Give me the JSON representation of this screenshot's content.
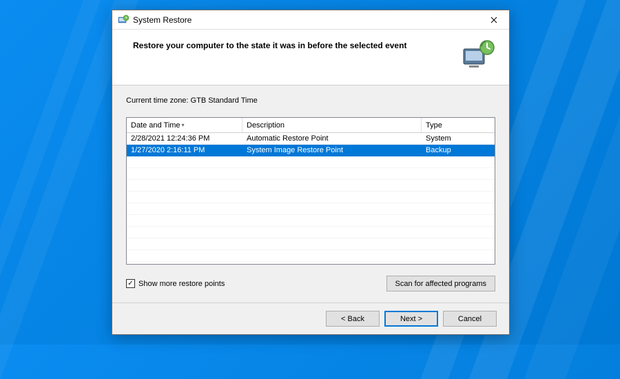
{
  "window": {
    "title": "System Restore"
  },
  "header": {
    "title": "Restore your computer to the state it was in before the selected event"
  },
  "timezone_label": "Current time zone: GTB Standard Time",
  "columns": {
    "datetime": "Date and Time",
    "description": "Description",
    "type": "Type"
  },
  "restore_points": [
    {
      "datetime": "2/28/2021 12:24:36 PM",
      "description": "Automatic Restore Point",
      "type": "System",
      "selected": false
    },
    {
      "datetime": "1/27/2020 2:16:11 PM",
      "description": "System Image Restore Point",
      "type": "Backup",
      "selected": true
    }
  ],
  "checkbox": {
    "label": "Show more restore points",
    "checked": true
  },
  "buttons": {
    "scan": "Scan for affected programs",
    "back": "< Back",
    "next": "Next >",
    "cancel": "Cancel"
  }
}
